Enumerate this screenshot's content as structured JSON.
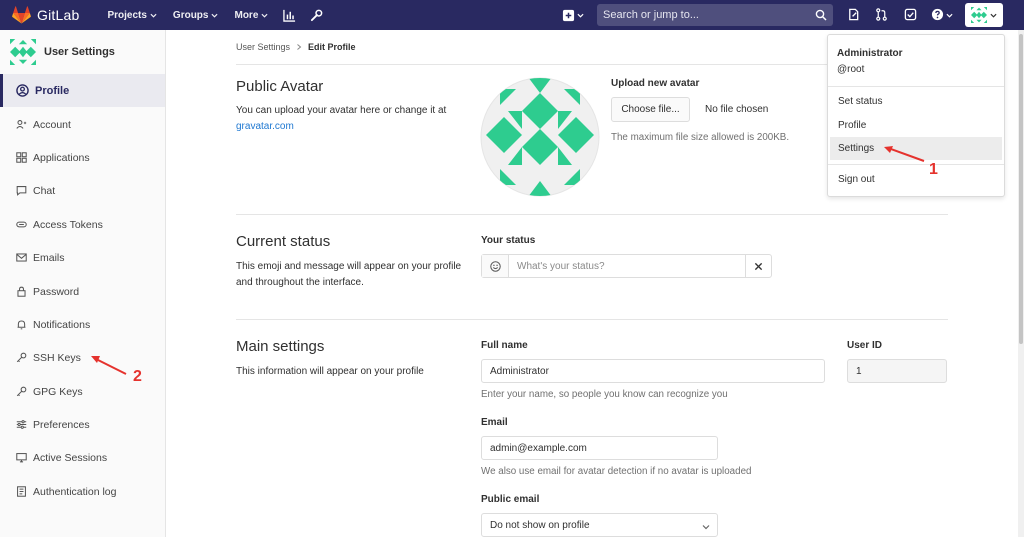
{
  "topnav": {
    "brand": "GitLab",
    "menus": [
      "Projects",
      "Groups",
      "More"
    ],
    "search_placeholder": "Search or jump to..."
  },
  "sidebar": {
    "title": "User Settings",
    "items": [
      {
        "label": "Profile",
        "icon": "profile-icon",
        "active": true
      },
      {
        "label": "Account",
        "icon": "account-icon"
      },
      {
        "label": "Applications",
        "icon": "applications-icon"
      },
      {
        "label": "Chat",
        "icon": "chat-icon"
      },
      {
        "label": "Access Tokens",
        "icon": "token-icon"
      },
      {
        "label": "Emails",
        "icon": "mail-icon"
      },
      {
        "label": "Password",
        "icon": "lock-icon"
      },
      {
        "label": "Notifications",
        "icon": "bell-icon"
      },
      {
        "label": "SSH Keys",
        "icon": "key-icon"
      },
      {
        "label": "GPG Keys",
        "icon": "key-icon"
      },
      {
        "label": "Preferences",
        "icon": "preferences-icon"
      },
      {
        "label": "Active Sessions",
        "icon": "monitor-icon"
      },
      {
        "label": "Authentication log",
        "icon": "log-icon"
      }
    ]
  },
  "breadcrumb": {
    "parent": "User Settings",
    "current": "Edit Profile"
  },
  "avatar_section": {
    "title": "Public Avatar",
    "desc_prefix": "You can upload your avatar here or change it at",
    "link": "gravatar.com",
    "upload_label": "Upload new avatar",
    "choose_button": "Choose file...",
    "no_file": "No file chosen",
    "max_size": "The maximum file size allowed is 200KB."
  },
  "status_section": {
    "title": "Current status",
    "desc": "This emoji and message will appear on your profile and throughout the interface.",
    "label": "Your status",
    "placeholder": "What's your status?"
  },
  "main_section": {
    "title": "Main settings",
    "desc": "This information will appear on your profile",
    "full_name_label": "Full name",
    "full_name_value": "Administrator",
    "full_name_help": "Enter your name, so people you know can recognize you",
    "user_id_label": "User ID",
    "user_id_value": "1",
    "email_label": "Email",
    "email_value": "admin@example.com",
    "email_help": "We also use email for avatar detection if no avatar is uploaded",
    "public_email_label": "Public email",
    "public_email_value": "Do not show on profile"
  },
  "user_menu": {
    "name": "Administrator",
    "username": "@root",
    "items": [
      "Set status",
      "Profile",
      "Settings",
      "Sign out"
    ],
    "highlighted": "Settings"
  },
  "annotations": [
    "1",
    "2"
  ],
  "colors": {
    "nav_bg": "#292961",
    "avatar_green": "#2ecc8f",
    "annotation_red": "#e5322d",
    "link": "#1f78d1"
  }
}
